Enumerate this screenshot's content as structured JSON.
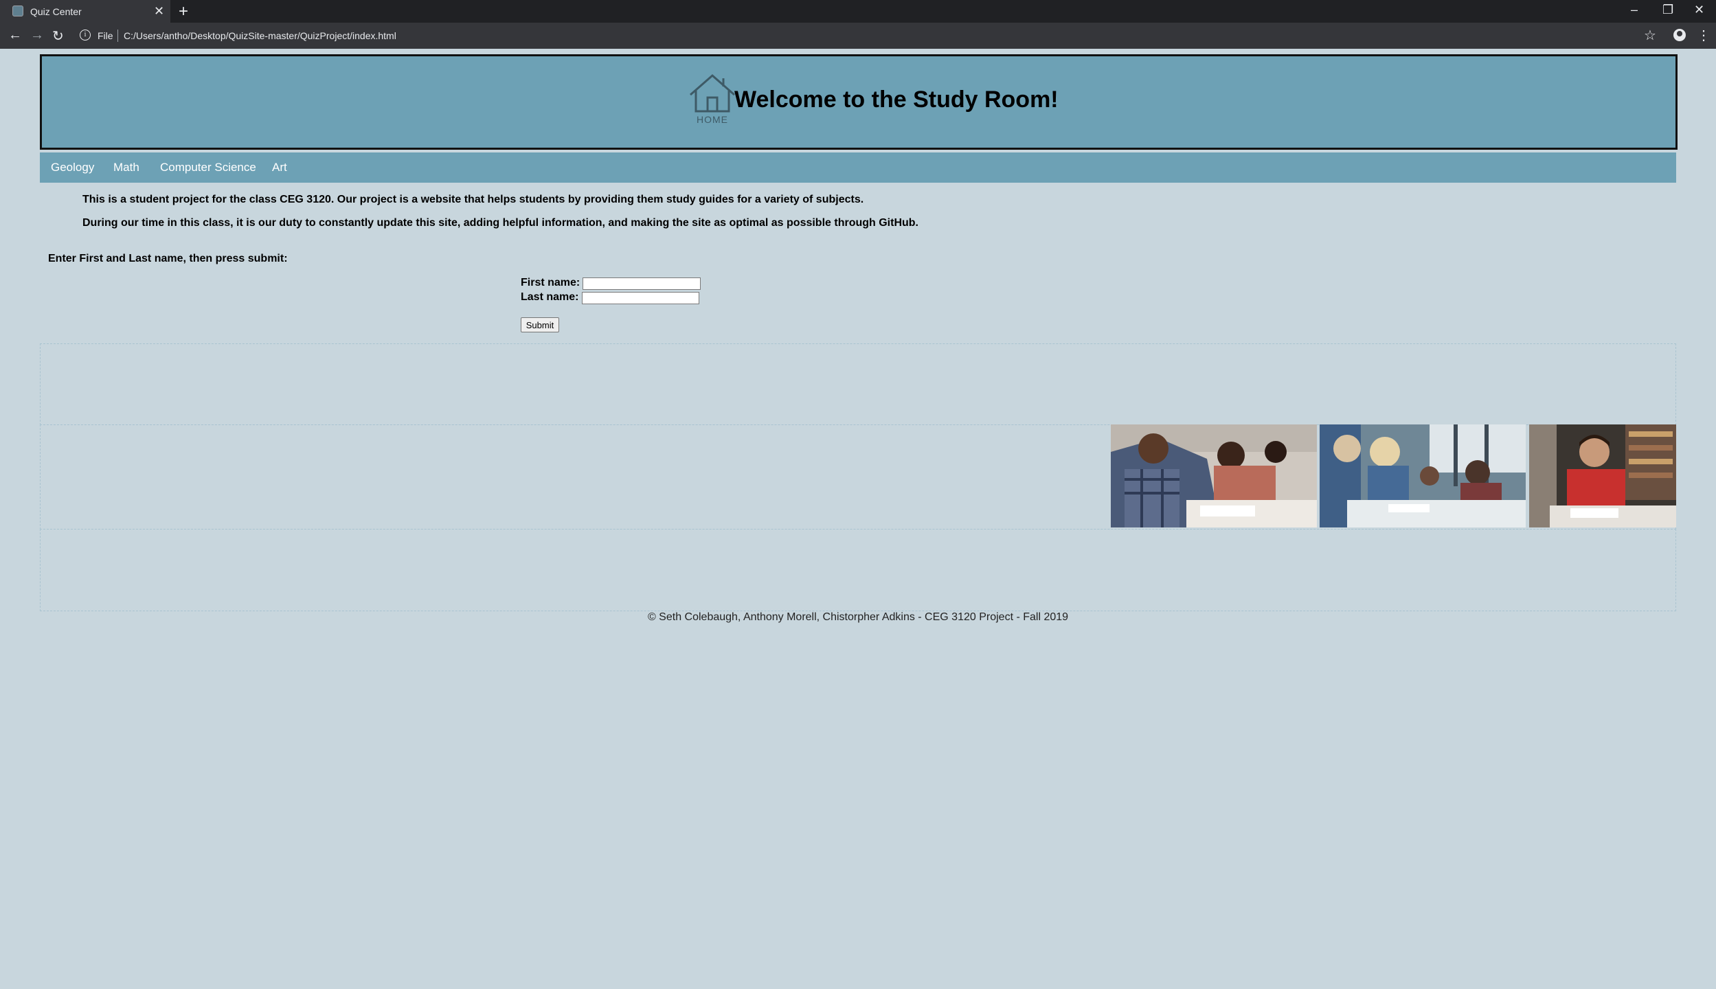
{
  "browser": {
    "tab_title": "Quiz Center",
    "tab_close": "✕",
    "new_tab": "+",
    "file_label": "File",
    "url": "C:/Users/antho/Desktop/QuizSite-master/QuizProject/index.html",
    "window_controls": {
      "minimize": "–",
      "restore": "❐",
      "close": "✕"
    }
  },
  "header": {
    "home_logo_text": "HOME",
    "title": "Welcome to the Study Room!"
  },
  "nav": {
    "items": [
      {
        "label": "Geology"
      },
      {
        "label": "Math"
      },
      {
        "label": "Computer Science"
      },
      {
        "label": "Art"
      }
    ]
  },
  "intro": {
    "line1": "This is a student project for the class CEG 3120. Our project is a website that helps students by providing them study guides for a variety of subjects.",
    "line2": "During our time in this class, it is our duty to constantly update this site, adding helpful information, and making the site as optimal as possible through GitHub."
  },
  "form": {
    "prompt": "Enter First and Last name, then press submit:",
    "first_name_label": "First name:",
    "first_name_value": "",
    "last_name_label": "Last name:",
    "last_name_value": "",
    "submit_label": "Submit"
  },
  "photos": [
    {
      "name": "students-writing-photo"
    },
    {
      "name": "students-group-study-photo"
    },
    {
      "name": "student-red-shirt-photo"
    }
  ],
  "footer": {
    "text": "© Seth Colebaugh, Anthony Morell, Chistorpher Adkins - CEG 3120 Project - Fall 2019"
  },
  "colors": {
    "page_bg": "#c8d6dd",
    "header_bg": "#6da1b5",
    "nav_bg": "#6da1b5"
  }
}
